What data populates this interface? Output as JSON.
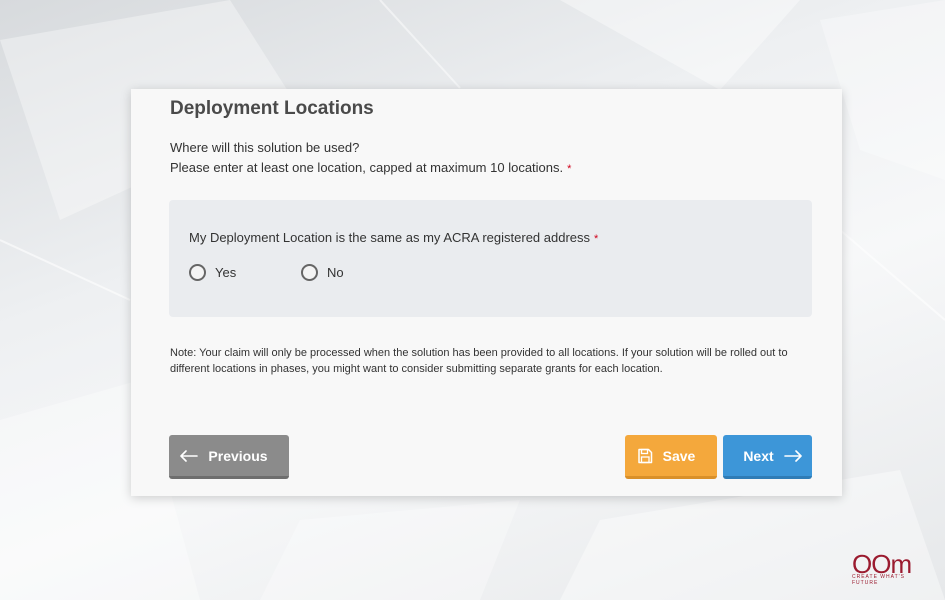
{
  "form": {
    "title": "Deployment Locations",
    "question_line1": "Where will this solution be used?",
    "question_line2": "Please enter at least one location, capped at maximum 10 locations.",
    "required_marker": "*",
    "address_question": {
      "label": "My Deployment Location is the same as my ACRA registered address",
      "options": [
        {
          "label": "Yes",
          "selected": false
        },
        {
          "label": "No",
          "selected": false
        }
      ]
    },
    "note": "Note: Your claim will only be processed when the solution has been provided to all locations. If your solution will be rolled out to different locations in phases, you might want to consider submitting separate grants for each location."
  },
  "buttons": {
    "previous": "Previous",
    "save": "Save",
    "next": "Next"
  },
  "colors": {
    "previous_bg": "#8b8b8b",
    "save_bg": "#f4a83c",
    "next_bg": "#3d96d8",
    "required": "#d0021b",
    "logo": "#9b1b2f"
  },
  "icons": {
    "previous": "arrow-left-icon",
    "save": "floppy-disk-icon",
    "next": "arrow-right-icon"
  },
  "logo": {
    "text": "OOm",
    "tagline": "CREATE WHAT'S FUTURE"
  }
}
